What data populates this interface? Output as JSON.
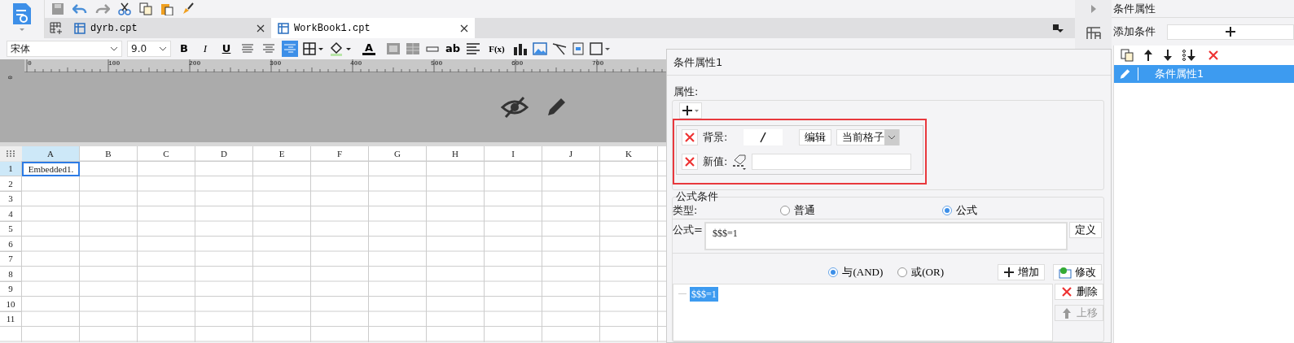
{
  "tabs": [
    {
      "label": "dyrb.cpt",
      "selected": false
    },
    {
      "label": "WorkBook1.cpt",
      "selected": true
    }
  ],
  "format_bar": {
    "font": "宋体",
    "size": "9.0",
    "styles": [
      "B",
      "I",
      "U"
    ],
    "alignment": [
      {
        "selected": false
      },
      {
        "selected": false
      },
      {
        "selected": true
      }
    ],
    "font_color_glyph": "A",
    "text_tool": "ab",
    "formula_tool": "F(x)"
  },
  "ruler": {
    "vertical": "0",
    "ticks": [
      "0",
      "100",
      "200",
      "300",
      "400",
      "500",
      "600",
      "700"
    ]
  },
  "sheet": {
    "columns": [
      {
        "label": "A",
        "selected": true
      },
      {
        "label": "B",
        "selected": false
      },
      {
        "label": "C",
        "selected": false
      },
      {
        "label": "D",
        "selected": false
      },
      {
        "label": "E",
        "selected": false
      },
      {
        "label": "F",
        "selected": false
      },
      {
        "label": "G",
        "selected": false
      },
      {
        "label": "H",
        "selected": false
      },
      {
        "label": "I",
        "selected": false
      },
      {
        "label": "J",
        "selected": false
      },
      {
        "label": "K",
        "selected": false
      }
    ],
    "rows": [
      {
        "label": "1",
        "selected": true,
        "cells": [
          "Embedded1."
        ]
      },
      {
        "label": "2",
        "selected": false
      },
      {
        "label": "3",
        "selected": false
      },
      {
        "label": "4",
        "selected": false
      },
      {
        "label": "5",
        "selected": false
      },
      {
        "label": "6",
        "selected": false
      },
      {
        "label": "7",
        "selected": false
      },
      {
        "label": "8",
        "selected": false
      },
      {
        "label": "9",
        "selected": false
      },
      {
        "label": "10",
        "selected": false
      },
      {
        "label": "11",
        "selected": false
      }
    ]
  },
  "dialog": {
    "title": "条件属性1",
    "properties_label": "属性:",
    "attributes": [
      {
        "kind": "background",
        "label": "背景:",
        "edit_button": "编辑",
        "scope": "当前格子"
      },
      {
        "kind": "new_value",
        "label": "新值:"
      }
    ],
    "formula_section": {
      "title": "公式条件",
      "type_label": "类型:",
      "types": [
        {
          "label": "普通",
          "selected": false
        },
        {
          "label": "公式",
          "selected": true
        }
      ],
      "formula_label": "公式=",
      "formula": "$$$=1",
      "define_button": "定义",
      "logic": [
        {
          "label": "与(AND)",
          "selected": true
        },
        {
          "label": "或(OR)",
          "selected": false
        }
      ],
      "add_button": "增加",
      "modify_button": "修改",
      "conditions": [
        {
          "text": "$$$=1",
          "selected": true
        }
      ],
      "delete_button": {
        "label": "删除",
        "disabled": false
      },
      "up_button": {
        "label": "上移",
        "disabled": true
      }
    }
  },
  "side_panel": {
    "title": "条件属性",
    "add_label": "添加条件",
    "items": [
      {
        "label": "条件属性1",
        "selected": true
      }
    ]
  }
}
